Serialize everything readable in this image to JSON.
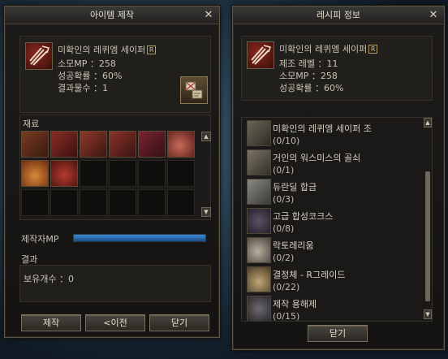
{
  "craft_window": {
    "title": "아이템 제작",
    "close_glyph": "✕",
    "item_name": "미확인의 레퀴엠 세이퍼",
    "grade": "R",
    "stats": [
      {
        "label": "소모MP",
        "sep": "：",
        "value": "258"
      },
      {
        "label": "성공확률",
        "sep": "：",
        "value": "60%"
      },
      {
        "label": "결과물수",
        "sep": "：",
        "value": "1"
      }
    ],
    "materials_label": "재료",
    "mp_label": "제작자MP",
    "mp_fraction": 1.0,
    "result_label": "결과",
    "owned_label": "보유개수",
    "owned_sep": "：",
    "owned_value": "0",
    "buttons": {
      "craft": "제작",
      "prev": "<이전",
      "close": "닫기"
    }
  },
  "recipe_window": {
    "title": "레시피 정보",
    "close_glyph": "✕",
    "item_name": "미확인의 레퀴엠 세이퍼",
    "grade": "R",
    "stats": [
      {
        "label": "제조 레벨",
        "sep": "：",
        "value": "11"
      },
      {
        "label": "소모MP",
        "sep": "：",
        "value": "258"
      },
      {
        "label": "성공확률",
        "sep": "：",
        "value": "60%"
      }
    ],
    "materials": [
      {
        "name": "미확인의  레퀴엠 세이퍼 조",
        "count": "(0/10)",
        "icon": "blueprint-icon"
      },
      {
        "name": "거인의 워스미스의 골쇠",
        "count": "(0/1)",
        "icon": "bone-icon"
      },
      {
        "name": "듀란딜 합금",
        "count": "(0/3)",
        "icon": "alloy-icon"
      },
      {
        "name": "고급 합성코크스",
        "count": "(0/8)",
        "icon": "coke-icon"
      },
      {
        "name": "락토레리움",
        "count": "(0/2)",
        "icon": "stone-icon"
      },
      {
        "name": "결정체 - R그레이드",
        "count": "(0/22)",
        "icon": "crystal-icon"
      },
      {
        "name": "제작 용해제",
        "count": "(0/15)",
        "icon": "solvent-icon"
      }
    ],
    "close_button": "닫기"
  }
}
